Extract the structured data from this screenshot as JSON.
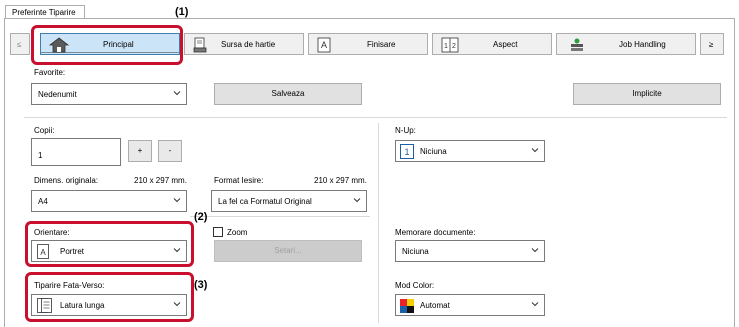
{
  "window": {
    "tab_title": "Preferinte Tiparire"
  },
  "nav": {
    "scroll_left": "≤",
    "scroll_right": "≥",
    "tabs": [
      {
        "label": "Principal",
        "icon": "home-icon",
        "selected": true
      },
      {
        "label": "Sursa de hartie",
        "icon": "paper-stack-icon"
      },
      {
        "label": "Finisare",
        "icon": "finishing-icon"
      },
      {
        "label": "Aspect",
        "icon": "layout-icon"
      },
      {
        "label": "Job Handling",
        "icon": "job-handling-icon"
      }
    ]
  },
  "callouts": {
    "c1": "(1)",
    "c2": "(2)",
    "c3": "(3)"
  },
  "favorites": {
    "label": "Favorite:",
    "value": "Nedenumit",
    "save_button": "Salveaza",
    "defaults_button": "Implicite"
  },
  "copies": {
    "label": "Copii:",
    "value": "1",
    "plus": "+",
    "minus": "-"
  },
  "original_size": {
    "label": "Dimens. originala:",
    "dims": "210 x 297 mm.",
    "value": "A4"
  },
  "output_size": {
    "label": "Format Iesire:",
    "dims": "210 x 297 mm.",
    "value": "La fel ca Formatul Original"
  },
  "orientation": {
    "label": "Orientare:",
    "value": "Portret",
    "icon": "portrait-page-icon"
  },
  "zoom": {
    "label": "Zoom",
    "checked": false,
    "settings_button": "Setari..."
  },
  "duplex": {
    "label": "Tiparire Fata-Verso:",
    "value": "Latura lunga",
    "icon": "duplex-long-edge-icon"
  },
  "nup": {
    "label": "N-Up:",
    "value": "Niciuna",
    "icon": "nup-1-icon",
    "icon_text": "1"
  },
  "doc_filing": {
    "label": "Memorare documente:",
    "value": "Niciuna"
  },
  "color_mode": {
    "label": "Mod Color:",
    "value": "Automat",
    "icon": "color-mode-icon"
  },
  "colors": {
    "highlight": "#c8102e",
    "button_bg": "#e1e1e1",
    "disabled_text": "#a0a0a0"
  }
}
